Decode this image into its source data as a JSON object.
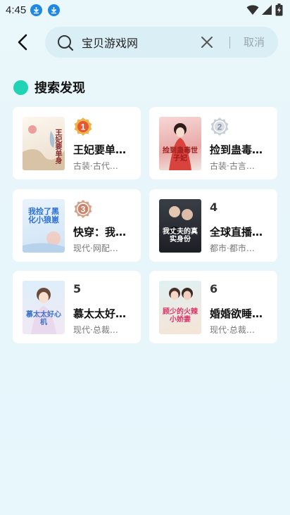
{
  "status": {
    "time": "4:45"
  },
  "search": {
    "value": "宝贝游戏网",
    "cancel_label": "取消"
  },
  "section": {
    "title": "搜索发现"
  },
  "books": [
    {
      "rank": "1",
      "title": "王妃要单…",
      "tags": "古装·古代…",
      "cover_text": "王妃要单身"
    },
    {
      "rank": "2",
      "title": "捡到蛊毒…",
      "tags": "古装·古言…",
      "cover_text": "捡到蛊毒世子妃"
    },
    {
      "rank": "3",
      "title": "快穿：我…",
      "tags": "现代·网配…",
      "cover_text": "我捡了黑化小狼崽"
    },
    {
      "rank": "4",
      "title": "全球直播…",
      "tags": "都市·都市…",
      "cover_text": "我丈夫的真实身份"
    },
    {
      "rank": "5",
      "title": "慕太太好…",
      "tags": "现代·总裁…",
      "cover_text": "慕太太好心机"
    },
    {
      "rank": "6",
      "title": "婚婚欲睡…",
      "tags": "现代·总裁…",
      "cover_text": "顾少的火辣小娇妻"
    }
  ],
  "colors": {
    "accent": "#20d3b4",
    "gold": "#e8a23a",
    "silver": "#b0b8c4",
    "bronze": "#c9876a"
  }
}
